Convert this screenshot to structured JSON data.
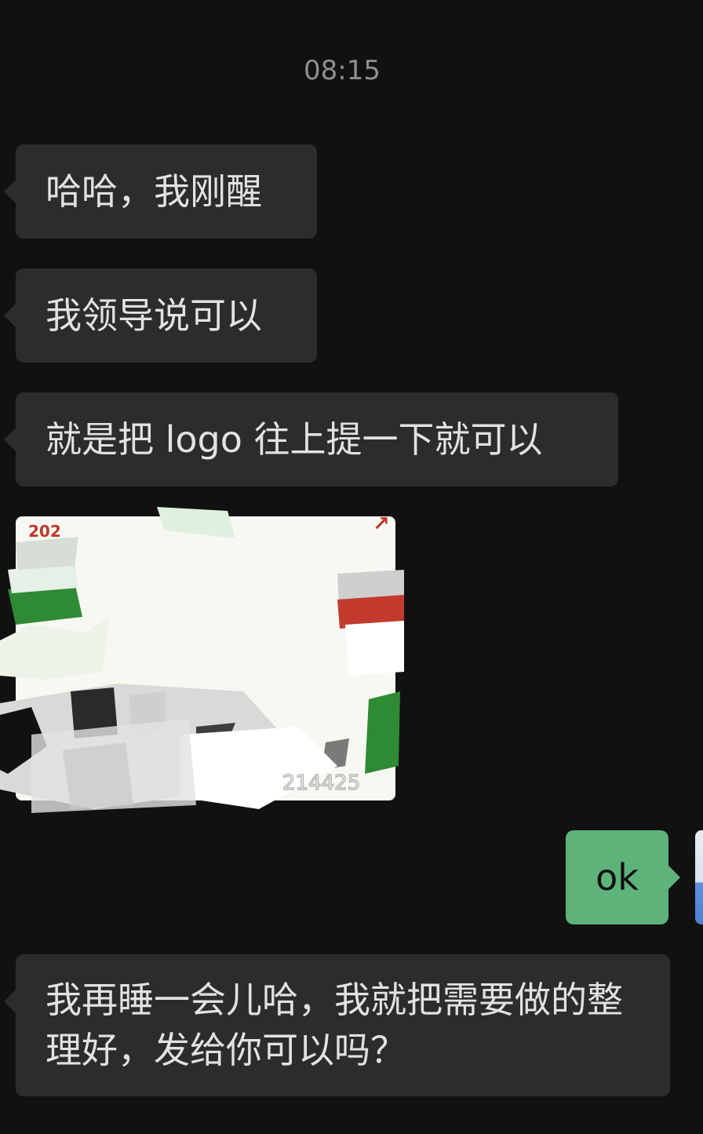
{
  "chat": {
    "timestamp": "08:15",
    "messages": [
      {
        "sender": "other",
        "type": "text",
        "text": "哈哈，我刚醒"
      },
      {
        "sender": "other",
        "type": "text",
        "text": "我领导说可以"
      },
      {
        "sender": "other",
        "type": "text",
        "text": "就是把 logo 往上提一下就可以"
      },
      {
        "sender": "other",
        "type": "image",
        "visible_text_top_left": "202",
        "visible_text_bottom_right": "214425"
      },
      {
        "sender": "me",
        "type": "text",
        "text": "ok"
      },
      {
        "sender": "other",
        "type": "text",
        "text": "我再睡一会儿哈，我就把需要做的整理好，发给你可以吗？"
      }
    ]
  },
  "colors": {
    "background": "#111111",
    "received_bubble": "#2c2c2c",
    "sent_bubble": "#5eb37a",
    "timestamp_text": "#8f8f8f"
  }
}
